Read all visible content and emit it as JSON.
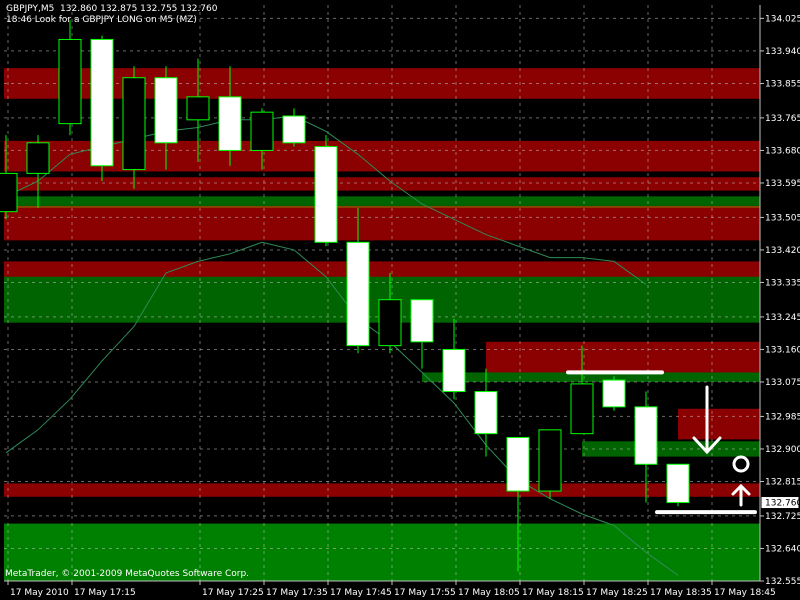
{
  "header": {
    "symbol_line": "GBPJPY,M5  132.860 132.875 132.755 132.760",
    "comment": "18:46 Look for a GBPJPY LONG on M5 (MZ)"
  },
  "footer": {
    "copyright": "MetaTrader, © 2001-2009 MetaQuotes Software Corp."
  },
  "colors": {
    "background": "#000000",
    "grid": "#c0c0c0",
    "candle_up_body": "#000000",
    "candle_down_body": "#ffffff",
    "candle_outline": "#00ff00",
    "zone_red": "#8b0000",
    "zone_green": "#006400",
    "zone_bright_green": "#008000",
    "zone_orange": "#8b4500",
    "ma_line": "#2e8b57",
    "annotation": "#ffffff"
  },
  "chart_data": {
    "type": "candlestick",
    "symbol": "GBPJPY",
    "timeframe": "M5",
    "last_price": "132.760",
    "ylim": [
      132.555,
      134.06
    ],
    "y_ticks": [
      "134.025",
      "133.940",
      "133.855",
      "133.765",
      "133.680",
      "133.595",
      "133.505",
      "133.420",
      "133.335",
      "133.245",
      "133.160",
      "133.075",
      "132.985",
      "132.900",
      "132.815",
      "132.725",
      "132.640",
      "132.555"
    ],
    "x_ticks": [
      {
        "i": 0,
        "label": "17 May 2010"
      },
      {
        "i": 2,
        "label": "17 May 17:15"
      },
      {
        "i": 6,
        "label": "17 May 17:25"
      },
      {
        "i": 8,
        "label": "17 May 17:35"
      },
      {
        "i": 10,
        "label": "17 May 17:45"
      },
      {
        "i": 12,
        "label": "17 May 17:55"
      },
      {
        "i": 14,
        "label": "17 May 18:05"
      },
      {
        "i": 16,
        "label": "17 May 18:15"
      },
      {
        "i": 18,
        "label": "17 May 18:25"
      },
      {
        "i": 20,
        "label": "17 May 18:35"
      },
      {
        "i": 22,
        "label": "17 May 18:45"
      }
    ],
    "candles": [
      {
        "o": 133.52,
        "h": 133.72,
        "l": 133.5,
        "c": 133.62
      },
      {
        "o": 133.62,
        "h": 133.72,
        "l": 133.53,
        "c": 133.7
      },
      {
        "o": 133.75,
        "h": 134.02,
        "l": 133.72,
        "c": 133.97
      },
      {
        "o": 133.97,
        "h": 133.98,
        "l": 133.6,
        "c": 133.64
      },
      {
        "o": 133.63,
        "h": 133.9,
        "l": 133.58,
        "c": 133.87
      },
      {
        "o": 133.87,
        "h": 133.9,
        "l": 133.63,
        "c": 133.7
      },
      {
        "o": 133.76,
        "h": 133.92,
        "l": 133.65,
        "c": 133.82
      },
      {
        "o": 133.82,
        "h": 133.9,
        "l": 133.64,
        "c": 133.68
      },
      {
        "o": 133.68,
        "h": 133.79,
        "l": 133.63,
        "c": 133.78
      },
      {
        "o": 133.77,
        "h": 133.79,
        "l": 133.69,
        "c": 133.7
      },
      {
        "o": 133.69,
        "h": 133.72,
        "l": 133.43,
        "c": 133.44
      },
      {
        "o": 133.44,
        "h": 133.53,
        "l": 133.15,
        "c": 133.17
      },
      {
        "o": 133.17,
        "h": 133.36,
        "l": 133.15,
        "c": 133.29
      },
      {
        "o": 133.29,
        "h": 133.29,
        "l": 133.11,
        "c": 133.18
      },
      {
        "o": 133.16,
        "h": 133.24,
        "l": 133.03,
        "c": 133.05
      },
      {
        "o": 133.05,
        "h": 133.11,
        "l": 132.88,
        "c": 132.94
      },
      {
        "o": 132.93,
        "h": 132.93,
        "l": 132.58,
        "c": 132.79
      },
      {
        "o": 132.79,
        "h": 132.95,
        "l": 132.77,
        "c": 132.95
      },
      {
        "o": 132.94,
        "h": 133.17,
        "l": 132.94,
        "c": 133.07
      },
      {
        "o": 133.08,
        "h": 133.09,
        "l": 133.0,
        "c": 133.01
      },
      {
        "o": 133.01,
        "h": 133.05,
        "l": 132.76,
        "c": 132.86
      },
      {
        "o": 132.86,
        "h": 132.86,
        "l": 132.75,
        "c": 132.76
      }
    ],
    "zones": [
      {
        "from": 133.815,
        "to": 133.895,
        "color": "red"
      },
      {
        "from": 133.625,
        "to": 133.705,
        "color": "red"
      },
      {
        "from": 133.575,
        "to": 133.61,
        "color": "red"
      },
      {
        "from": 133.535,
        "to": 133.56,
        "color": "green"
      },
      {
        "from": 133.5,
        "to": 133.535,
        "color": "orange"
      },
      {
        "from": 133.445,
        "to": 133.53,
        "color": "red"
      },
      {
        "from": 133.3,
        "to": 133.39,
        "color": "red"
      },
      {
        "from": 133.23,
        "to": 133.35,
        "color": "green"
      },
      {
        "from": 133.095,
        "to": 133.18,
        "color": "red"
      },
      {
        "from": 133.075,
        "to": 133.1,
        "color": "green"
      },
      {
        "from": 132.925,
        "to": 133.005,
        "color": "red"
      },
      {
        "from": 132.88,
        "to": 132.92,
        "color": "green"
      },
      {
        "from": 132.775,
        "to": 132.81,
        "color": "red"
      },
      {
        "from": 132.555,
        "to": 132.705,
        "color": "bright_green"
      }
    ],
    "ma_upper": [
      [
        0,
        133.56
      ],
      [
        1,
        133.6
      ],
      [
        2,
        133.67
      ],
      [
        3,
        133.69
      ],
      [
        4,
        133.71
      ],
      [
        5,
        133.73
      ],
      [
        6,
        133.74
      ],
      [
        7,
        133.76
      ],
      [
        8,
        133.76
      ],
      [
        9,
        133.77
      ],
      [
        10,
        133.73
      ],
      [
        11,
        133.67
      ],
      [
        12,
        133.6
      ],
      [
        13,
        133.54
      ],
      [
        14,
        133.5
      ],
      [
        15,
        133.46
      ],
      [
        16,
        133.43
      ],
      [
        17,
        133.4
      ],
      [
        18,
        133.4
      ],
      [
        19,
        133.39
      ],
      [
        20,
        133.33
      ]
    ],
    "ma_lower": [
      [
        0,
        132.89
      ],
      [
        1,
        132.95
      ],
      [
        2,
        133.03
      ],
      [
        3,
        133.13
      ],
      [
        4,
        133.22
      ],
      [
        5,
        133.36
      ],
      [
        6,
        133.39
      ],
      [
        7,
        133.41
      ],
      [
        8,
        133.44
      ],
      [
        9,
        133.42
      ],
      [
        10,
        133.35
      ],
      [
        11,
        133.24
      ],
      [
        12,
        133.18
      ],
      [
        13,
        133.1
      ],
      [
        14,
        133.02
      ],
      [
        15,
        132.91
      ],
      [
        16,
        132.82
      ],
      [
        17,
        132.77
      ],
      [
        18,
        132.73
      ],
      [
        19,
        132.7
      ],
      [
        20,
        132.63
      ],
      [
        21,
        132.57
      ]
    ]
  }
}
